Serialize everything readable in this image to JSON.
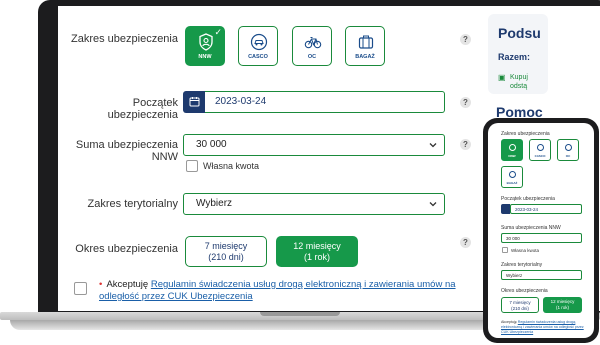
{
  "form": {
    "scope_label": "Zakres ubezpieczenia",
    "scope_options": [
      {
        "label": "NNW",
        "icon": "shield-person-icon",
        "selected": true
      },
      {
        "label": "CASCO",
        "icon": "car-shield-icon",
        "selected": false
      },
      {
        "label": "OC",
        "icon": "bicycle-icon",
        "selected": false
      },
      {
        "label": "BAGAŻ",
        "icon": "luggage-icon",
        "selected": false
      }
    ],
    "start_label": "Początek ubezpieczenia",
    "start_value": "2023-03-24",
    "sum_label": "Suma ubezpieczenia NNW",
    "sum_value": "30 000",
    "own_amount_label": "Własna kwota",
    "territory_label": "Zakres terytorialny",
    "territory_value": "Wybierz",
    "period_label": "Okres ubezpieczenia",
    "period_options": [
      {
        "line1": "7 miesięcy",
        "line2": "(210 dni)",
        "selected": false
      },
      {
        "line1": "12 miesięcy",
        "line2": "(1 rok)",
        "selected": true
      }
    ],
    "accept_prefix": "Akceptuję",
    "accept_link": "Regulamin świadczenia usług drogą elektroniczną i zawierania umów na odległość przez CUK Ubezpieczenia",
    "help_symbol": "?"
  },
  "summary": {
    "title": "Podsu",
    "scope_prefix": "Razem:",
    "buy_text_1": "Kupuj",
    "buy_text_2": "odstą",
    "help_title": "Pomoc"
  },
  "phone": {
    "scope_label": "Zakres ubezpieczenia",
    "tiles": [
      "NNW",
      "CASCO",
      "OC",
      "BAGAŻ"
    ],
    "start_label": "Początek ubezpieczenia",
    "start_value": "2023-03-24",
    "sum_label": "Suma ubezpieczenia NNW",
    "sum_value": "30 000",
    "own_amount_label": "Własna kwota",
    "territory_label": "Zakres terytorialny",
    "territory_value": "Wybierz",
    "period_label": "Okres ubezpieczenia",
    "period_a_1": "7 miesięcy",
    "period_a_2": "(210 dni)",
    "period_b_1": "12 miesięcy",
    "period_b_2": "(1 rok)",
    "accept_prefix": "Akceptuję",
    "accept_link": "Regulamin świadczenia usług drogą elektroniczną i zawierania umów na odległość przez CUK Ubezpieczenia"
  },
  "colors": {
    "accent": "#16994a",
    "navy": "#1e3a6e",
    "link": "#1a5fa8"
  }
}
